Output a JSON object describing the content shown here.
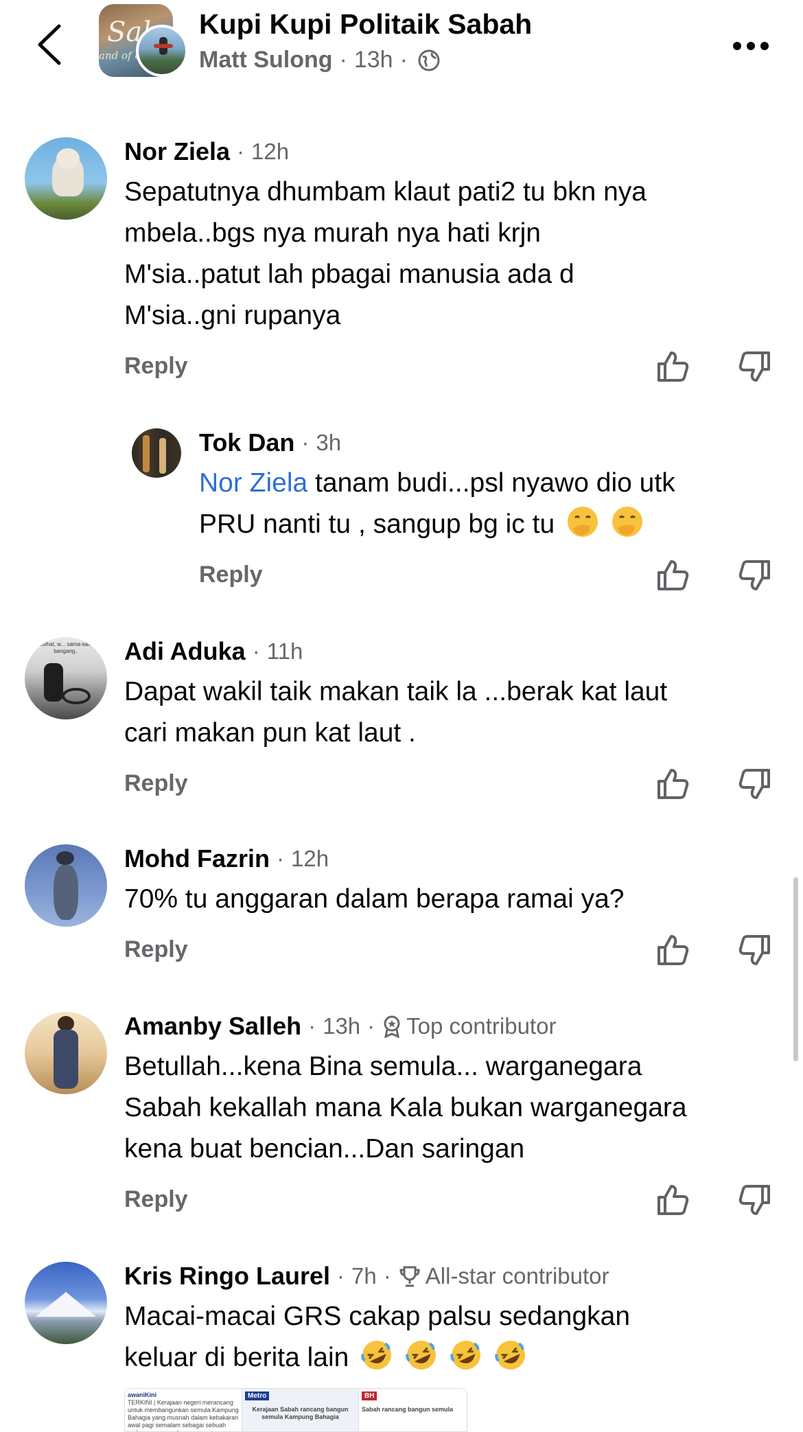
{
  "header": {
    "group_name": "Kupi Kupi Politaik Sabah",
    "poster_name": "Matt Sulong",
    "time": "13h",
    "group_avatar_text": "Sab",
    "group_avatar_subtext": "and of c"
  },
  "comments": [
    {
      "author": "Nor Ziela",
      "time": "12h",
      "lines": [
        "Sepatutnya dhumbam klaut pati2 tu bkn nya",
        "mbela..bgs nya murah nya hati krjn",
        "M'sia..patut lah pbagai manusia ada d",
        "M'sia..gni rupanya"
      ],
      "reply_label": "Reply"
    },
    {
      "author": "Tok Dan",
      "time": "3h",
      "mention": "Nor Ziela",
      "line1_rest": " tanam budi...psl nyawo dio utk",
      "line2": "PRU nanti tu , sangup bg ic tu",
      "reply_label": "Reply"
    },
    {
      "author": "Adi Aduka",
      "time": "11h",
      "avatar_text": "nasihat, w... sama-sama bangang..",
      "lines": [
        "Dapat wakil taik makan taik la ...berak kat laut",
        "cari makan pun kat laut ."
      ],
      "reply_label": "Reply"
    },
    {
      "author": "Mohd Fazrin",
      "time": "12h",
      "lines": [
        "70% tu anggaran dalam berapa ramai ya?"
      ],
      "reply_label": "Reply"
    },
    {
      "author": "Amanby Salleh",
      "time": "13h",
      "badge": "Top contributor",
      "lines": [
        "Betullah...kena Bina semula... warganegara",
        "Sabah kekallah mana Kala bukan warganegara",
        "kena buat bencian...Dan saringan"
      ],
      "reply_label": "Reply"
    },
    {
      "author": "Kris Ringo Laurel",
      "time": "7h",
      "badge": "All-star contributor",
      "lines": [
        "Macai-macai GRS cakap palsu sedangkan",
        "keluar di berita lain"
      ]
    }
  ],
  "link_preview": {
    "col1_source": "awaniKini",
    "col1_text": "TERKINI | Kerajaan negeri merancang untuk membangunkan semula Kampung Bahagia yang musnah dalam kebakaran awal pagi semalam sebagai sebuah perkampungan sah.",
    "col2_source": "Metro",
    "col2_text": "Kerajaan Sabah rancang bangun semula Kampung Bahagia",
    "col3_source": "BH",
    "col3_text": "Sabah rancang bangun semula"
  },
  "colors": {
    "accent_link": "#2d6ed8",
    "meta_gray": "#65676b",
    "text": "#050505"
  },
  "icons": [
    "back-chevron-icon",
    "globe-icon",
    "more-icon",
    "like-icon",
    "dislike-icon",
    "top-contributor-icon",
    "all-star-icon",
    "hand-over-mouth-emoji",
    "rolling-laughing-emoji"
  ]
}
